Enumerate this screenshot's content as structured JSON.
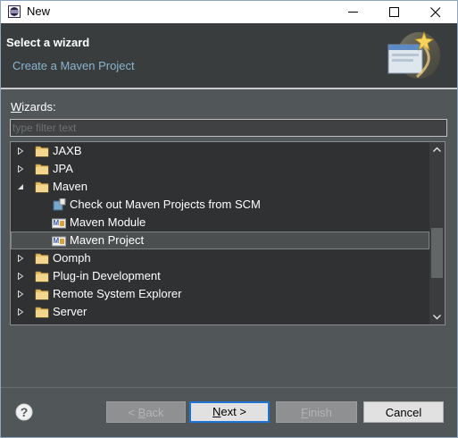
{
  "window": {
    "title": "New",
    "minimize_label": "Minimize",
    "maximize_label": "Maximize",
    "close_label": "Close"
  },
  "header": {
    "title": "Select a wizard",
    "description": "Create a Maven Project"
  },
  "wizards": {
    "label_underlined": "W",
    "label_rest": "izards:",
    "filter_placeholder": "type filter text",
    "filter_value": ""
  },
  "tree": {
    "items": [
      {
        "label": "JAXB",
        "type": "folder",
        "expanded": false
      },
      {
        "label": "JPA",
        "type": "folder",
        "expanded": false
      },
      {
        "label": "Maven",
        "type": "folder",
        "expanded": true
      },
      {
        "label": "Check out Maven Projects from SCM",
        "type": "maven-scm",
        "child": true
      },
      {
        "label": "Maven Module",
        "type": "maven",
        "child": true
      },
      {
        "label": "Maven Project",
        "type": "maven",
        "child": true,
        "selected": true
      },
      {
        "label": "Oomph",
        "type": "folder",
        "expanded": false
      },
      {
        "label": "Plug-in Development",
        "type": "folder",
        "expanded": false
      },
      {
        "label": "Remote System Explorer",
        "type": "folder",
        "expanded": false
      },
      {
        "label": "Server",
        "type": "folder",
        "expanded": false
      }
    ]
  },
  "footer": {
    "help_glyph": "?",
    "back_pre": "< ",
    "back_key": "B",
    "back_post": "ack",
    "next_key": "N",
    "next_post": "ext >",
    "finish_key": "F",
    "finish_post": "inish",
    "cancel_label": "Cancel"
  },
  "colors": {
    "accent": "#1e74d0",
    "folder": "#e8c06a",
    "header_bg": "#3a3d3e",
    "body_bg": "#515658"
  }
}
